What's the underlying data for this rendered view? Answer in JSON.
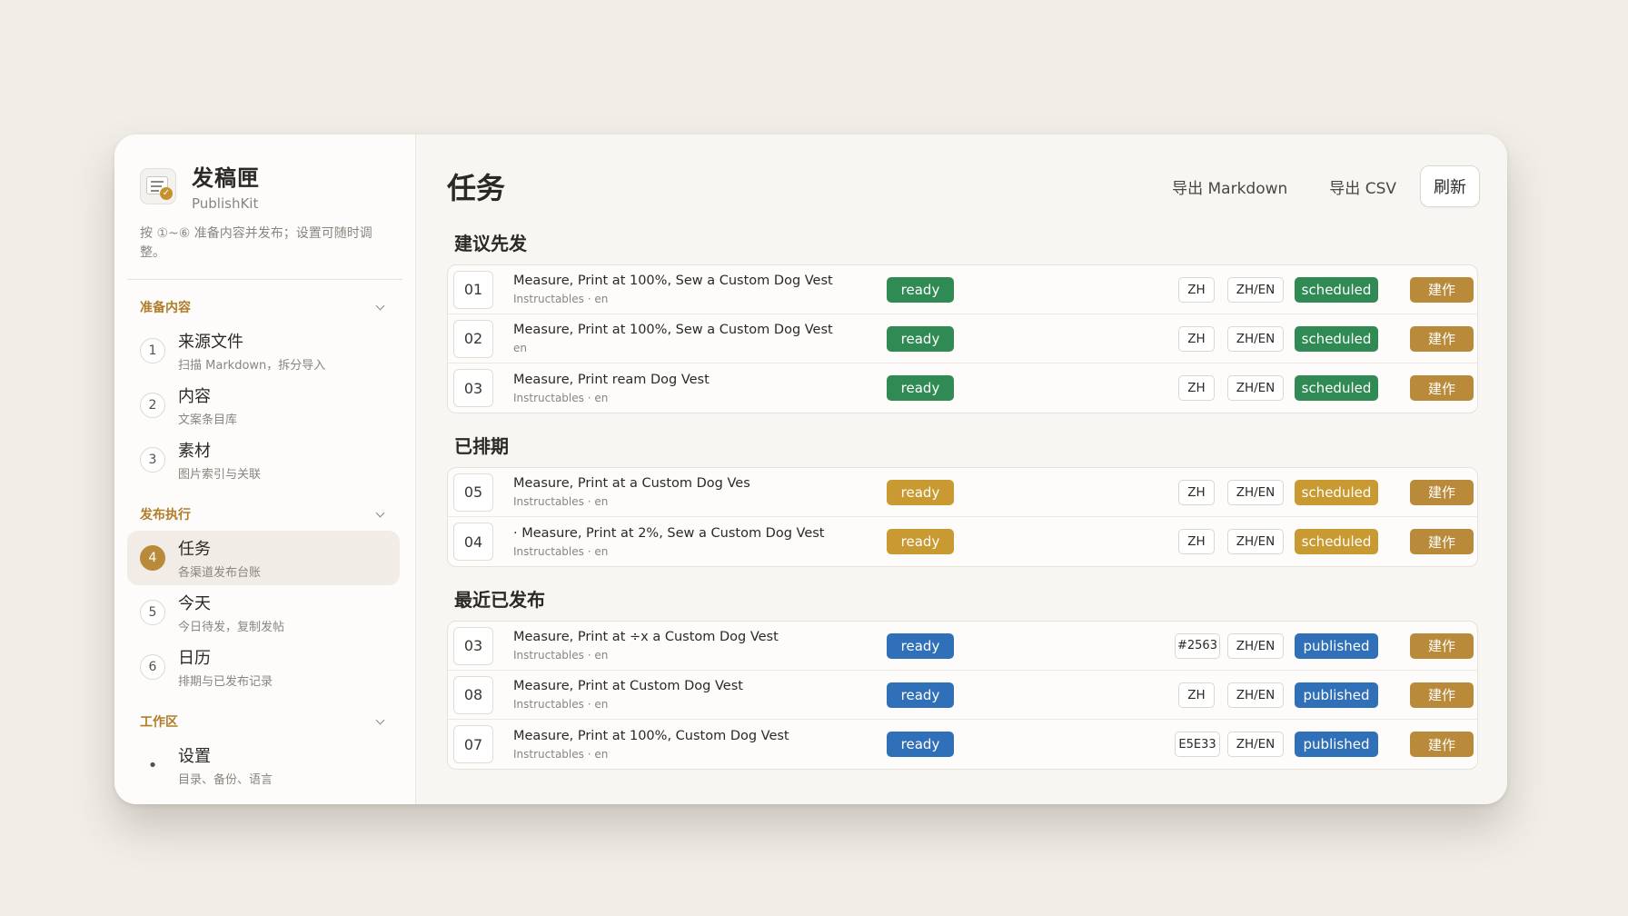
{
  "brand": {
    "title": "发稿匣",
    "subtitle": "PublishKit"
  },
  "hint": "按 ①~⑥ 准备内容并发布；设置可随时调整。",
  "sidebar": {
    "sections": [
      {
        "title": "准备内容",
        "items": [
          {
            "num": "1",
            "label": "来源文件",
            "sub": "扫描 Markdown，拆分导入"
          },
          {
            "num": "2",
            "label": "内容",
            "sub": "文案条目库"
          },
          {
            "num": "3",
            "label": "素材",
            "sub": "图片索引与关联"
          }
        ]
      },
      {
        "title": "发布执行",
        "items": [
          {
            "num": "4",
            "label": "任务",
            "sub": "各渠道发布台账"
          },
          {
            "num": "5",
            "label": "今天",
            "sub": "今日待发，复制发帖"
          },
          {
            "num": "6",
            "label": "日历",
            "sub": "排期与已发布记录"
          }
        ]
      },
      {
        "title": "工作区",
        "items": [
          {
            "num": "•",
            "label": "设置",
            "sub": "目录、备份、语言"
          }
        ]
      }
    ]
  },
  "main": {
    "title": "任务",
    "actions": {
      "export_md": "导出 Markdown",
      "export_csv": "导出 CSV",
      "refresh": "刷新"
    },
    "groups": [
      {
        "title": "建议先发",
        "rows": [
          {
            "num": "01",
            "title": "Measure, Print at 100%, Sew a Custom Dog Vest",
            "sub": "Instructables · en",
            "status": "ready",
            "lang": "ZH",
            "lang2": "ZH/EN",
            "state": "scheduled",
            "action": "建作"
          },
          {
            "num": "02",
            "title": "Measure, Print at 100%, Sew a Custom Dog Vest",
            "sub": "en",
            "status": "ready",
            "lang": "ZH",
            "lang2": "ZH/EN",
            "state": "scheduled",
            "action": "建作"
          },
          {
            "num": "03",
            "title": "Measure, Print ream Dog Vest",
            "sub": "Instructables · en",
            "status": "ready",
            "lang": "ZH",
            "lang2": "ZH/EN",
            "state": "scheduled",
            "action": "建作"
          }
        ]
      },
      {
        "title": "已排期",
        "rows": [
          {
            "num": "05",
            "title": "Measure, Print at a Custom Dog Ves",
            "sub": "Instructables · en",
            "status": "ready",
            "lang": "ZH",
            "lang2": "ZH/EN",
            "state": "scheduled",
            "action": "建作"
          },
          {
            "num": "04",
            "title": "· Measure, Print at 2%, Sew a Custom Dog Vest",
            "sub": "Instructables · en",
            "status": "ready",
            "lang": "ZH",
            "lang2": "ZH/EN",
            "state": "scheduled",
            "action": "建作"
          }
        ]
      },
      {
        "title": "最近已发布",
        "rows": [
          {
            "num": "03",
            "title": "Measure, Print at ÷x a Custom Dog Vest",
            "sub": "Instructables · en",
            "status": "ready",
            "lang": "#2563",
            "lang2": "ZH/EN",
            "state": "published",
            "action": "建作"
          },
          {
            "num": "08",
            "title": "Measure, Print at Custom Dog Vest",
            "sub": "Instructables · en",
            "status": "ready",
            "lang": "ZH",
            "lang2": "ZH/EN",
            "state": "published",
            "action": "建作"
          },
          {
            "num": "07",
            "title": "Measure, Print at 100%, Custom Dog Vest",
            "sub": "Instructables · en",
            "status": "ready",
            "lang": "E5E33",
            "lang2": "ZH/EN",
            "state": "published",
            "action": "建作"
          }
        ]
      }
    ]
  },
  "colors": {
    "ready_green": "#2f8a53",
    "ready_yellow": "#c99a32",
    "ready_blue": "#3070b8",
    "accent": "#b88a3a"
  }
}
